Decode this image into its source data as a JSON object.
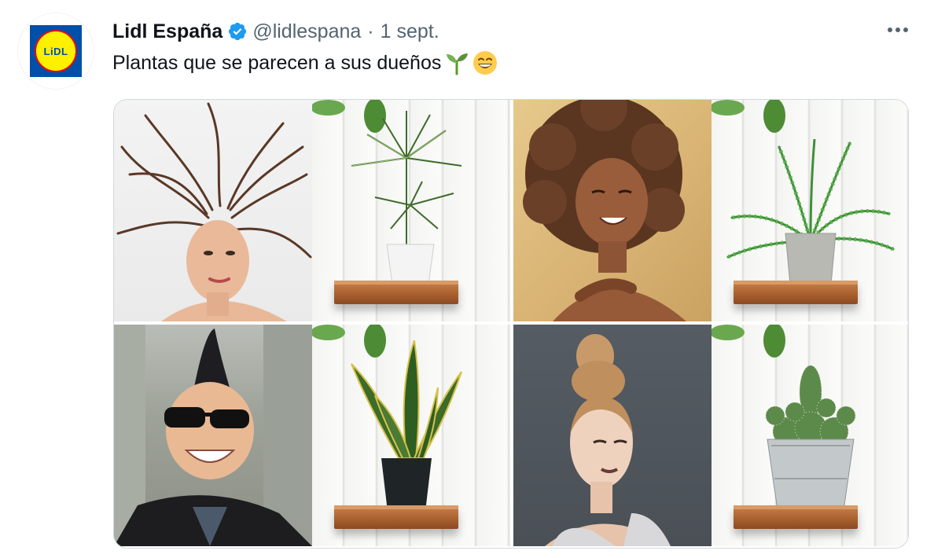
{
  "account": {
    "display_name": "Lidl España",
    "handle": "@lidlespana",
    "separator": "·",
    "date": "1 sept.",
    "avatar_text": "LiDL",
    "verified_color": "#1d9bf0"
  },
  "tweet": {
    "text": "Plantas que se parecen a sus dueños",
    "emojis": [
      "seedling-emoji",
      "grinning-face-emoji"
    ]
  },
  "media": {
    "tiles": [
      {
        "portrait": "woman with flowing wild hair",
        "plant": "dracaena in white pot"
      },
      {
        "portrait": "smiling woman with curly afro hair",
        "plant": "fern in concrete pot"
      },
      {
        "portrait": "man with mohawk and sunglasses",
        "plant": "snake plant in black pot"
      },
      {
        "portrait": "woman with high top bun",
        "plant": "cactus in metal bucket"
      }
    ]
  },
  "colors": {
    "text_primary": "#0f1419",
    "text_secondary": "#536471",
    "border": "#cfd9de",
    "lidl_blue": "#0050aa",
    "lidl_yellow": "#fff000",
    "lidl_red": "#e60a14"
  }
}
